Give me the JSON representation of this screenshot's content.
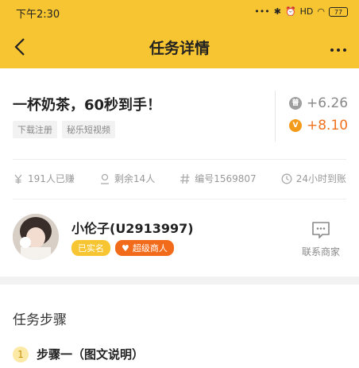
{
  "status_bar": {
    "time": "下午2:30",
    "signal": "HD",
    "battery": "77"
  },
  "app_bar": {
    "title": "任务详情"
  },
  "task": {
    "title": "一杯奶茶，60秒到手！",
    "tags": [
      "下载注册",
      "秘乐短视频"
    ],
    "reward_normal_badge": "普",
    "reward_normal": "+6.26",
    "reward_vip_badge": "V",
    "reward_vip": "+8.10"
  },
  "stats": {
    "earned": "191人已赚",
    "remaining": "剩余14人",
    "number": "编号1569807",
    "payout": "24小时到账"
  },
  "publisher": {
    "name": "小伦子(U2913997)",
    "verified_label": "已实名",
    "merchant_label": "超级商人",
    "contact_label": "联系商家"
  },
  "steps": {
    "title": "任务步骤",
    "items": [
      {
        "number": "1",
        "label": "步骤一（图文说明）"
      }
    ]
  },
  "colors": {
    "brand": "#f7c531",
    "vip": "#f0711e",
    "merchant": "#f26b1a"
  }
}
